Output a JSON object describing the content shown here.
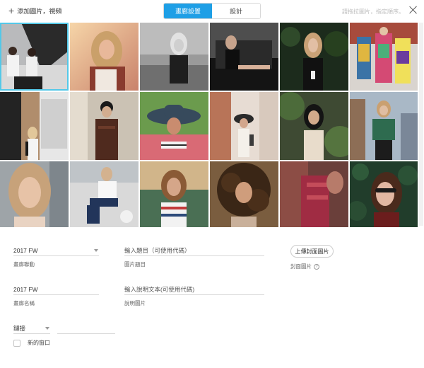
{
  "toolbar": {
    "add_media_label": "添加圖片，視頻",
    "hint": "請拖拉圖片，指定順序。"
  },
  "tabs": [
    {
      "label": "畫廊設置",
      "active": true
    },
    {
      "label": "設計",
      "active": false
    }
  ],
  "gallery": {
    "photos": [
      {
        "desc": "two-girls-studio",
        "selected": true
      },
      {
        "desc": "blonde-sunlit-portrait"
      },
      {
        "desc": "bw-blonde-field"
      },
      {
        "desc": "woman-on-black-sofa"
      },
      {
        "desc": "woman-forest-black-top"
      },
      {
        "desc": "colorful-fashion-street"
      },
      {
        "desc": "blonde-shutters-street"
      },
      {
        "desc": "woman-brown-shirt-wall"
      },
      {
        "desc": "woman-floppy-hat"
      },
      {
        "desc": "woman-black-hat-city"
      },
      {
        "desc": "woman-lace-dress-wall"
      },
      {
        "desc": "woman-green-jacket-city"
      },
      {
        "desc": "blonde-closeup-portrait"
      },
      {
        "desc": "woman-sitting-jeans"
      },
      {
        "desc": "braids-striped-sweater"
      },
      {
        "desc": "curly-hair-portrait"
      },
      {
        "desc": "woman-red-sweater"
      },
      {
        "desc": "woman-sunglasses-ivy"
      }
    ]
  },
  "form": {
    "gallery_action": {
      "value": "2017 FW",
      "label": "畫廊聯動"
    },
    "gallery_name": {
      "value": "2017 FW",
      "label": "畫廊名稱"
    },
    "image_title": {
      "placeholder": "輸入題目（可使用代碼）",
      "label": "圖片題目"
    },
    "image_desc": {
      "placeholder": "輸入說明文本(可使用代碼)",
      "label": "說明圖片"
    },
    "upload_cover_button": "上傳封面圖片",
    "cover_label": "封面圖片",
    "help_glyph": "?",
    "link": {
      "value": "鏈接"
    },
    "new_window_label": "新的窗口"
  },
  "colors": {
    "accent": "#1e9fe6",
    "selected_outline": "#53c8e8"
  }
}
